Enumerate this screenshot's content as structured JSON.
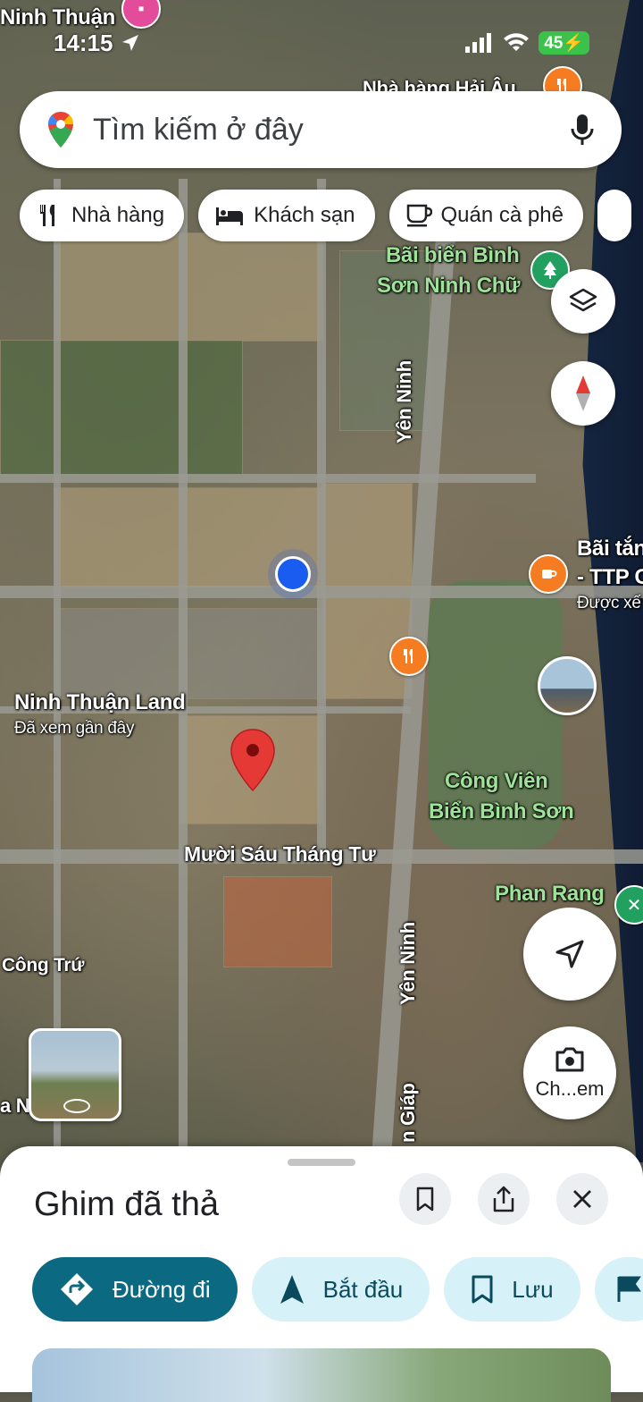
{
  "status": {
    "time": "14:15",
    "battery": "45"
  },
  "search": {
    "placeholder": "Tìm kiếm ở đây"
  },
  "chips": [
    {
      "label": "Nhà hàng",
      "icon": "restaurant-icon"
    },
    {
      "label": "Khách sạn",
      "icon": "hotel-icon"
    },
    {
      "label": "Quán cà phê",
      "icon": "coffee-icon"
    }
  ],
  "map_labels": {
    "ninh_thuan": "Ninh Thuận",
    "nha_hang_hai_au": "Nhà hàng Hải Âu",
    "bai_bien_1": "Bãi biển Bình",
    "bai_bien_2": "Sơn Ninh Chữ",
    "yen_ninh": "Yên Ninh",
    "bai_tam_1": "Bãi tắn",
    "bai_tam_2": "- TTP C",
    "bai_tam_3": "Được xế",
    "ninh_thuan_land": "Ninh Thuận Land",
    "da_xem": "Đã xem gần đây",
    "cong_vien_1": "Công Viên",
    "cong_vien_2": "Biển Bình Sơn",
    "muoi_sau": "Mười Sáu Tháng Tư",
    "phan_rang": "Phan Rang",
    "cong_tru": "Công Trứ",
    "yen_ninh_2": "Yên Ninh",
    "giap": "n Giáp",
    "la_n": "a N",
    "ch_em": "Ch...em"
  },
  "sheet": {
    "title": "Ghim đã thả",
    "actions": [
      {
        "label": "Đường đi"
      },
      {
        "label": "Bắt đầu"
      },
      {
        "label": "Lưu"
      }
    ]
  }
}
